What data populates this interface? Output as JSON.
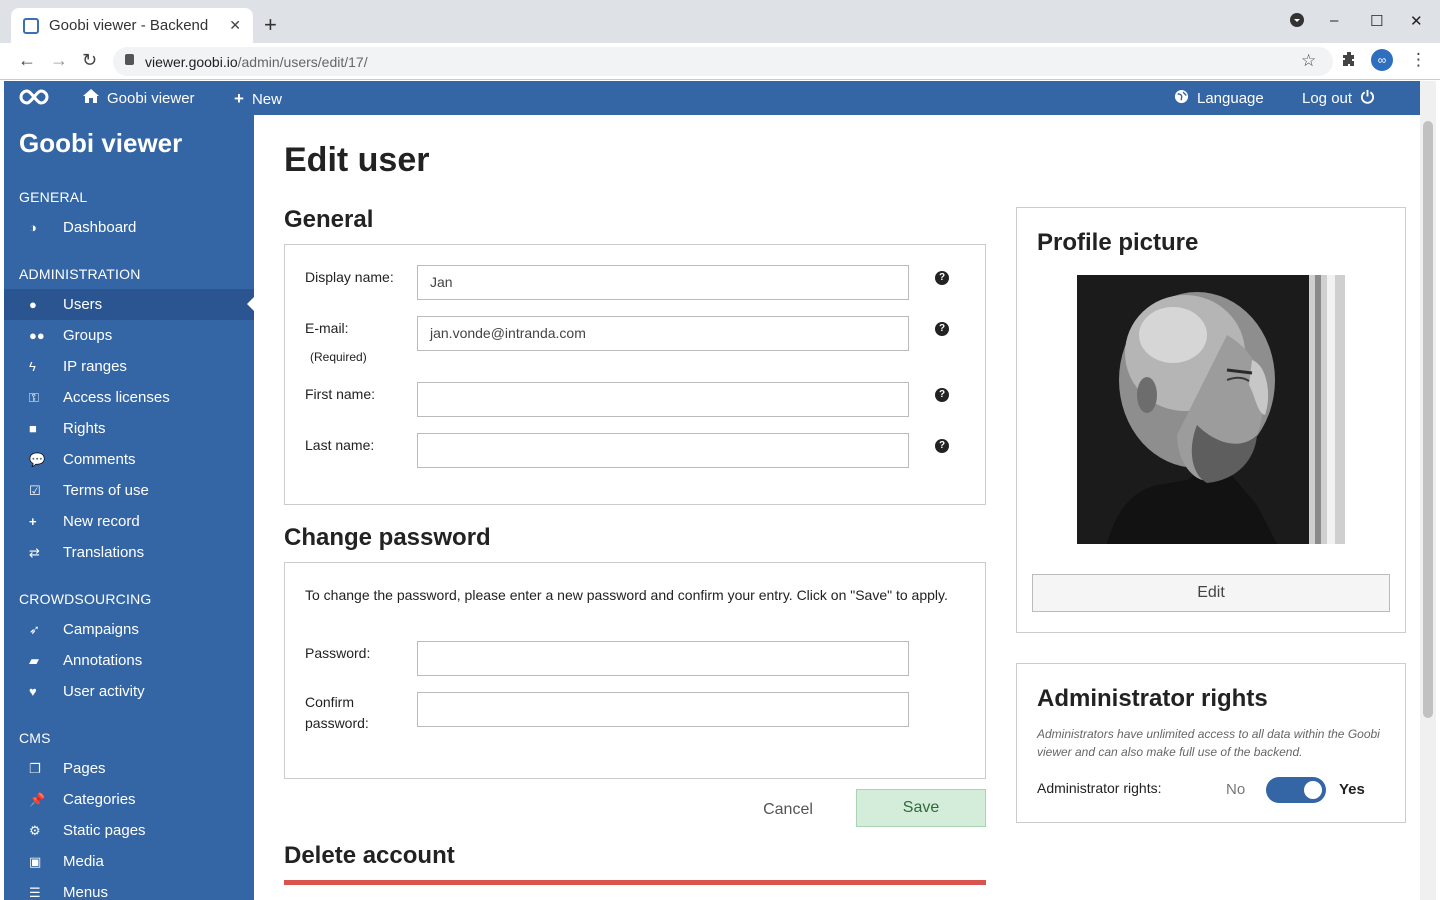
{
  "browser": {
    "tab_title": "Goobi viewer - Backend",
    "url_host": "viewer.goobi.io",
    "url_path": "/admin/users/edit/17/"
  },
  "topnav": {
    "home": "Goobi viewer",
    "new": "New",
    "language": "Language",
    "logout": "Log out"
  },
  "sidebar": {
    "brand": "Goobi viewer",
    "sections": {
      "general": "GENERAL",
      "administration": "ADMINISTRATION",
      "crowdsourcing": "CROWDSOURCING",
      "cms": "CMS"
    },
    "items": {
      "dashboard": "Dashboard",
      "users": "Users",
      "groups": "Groups",
      "ip_ranges": "IP ranges",
      "access_licenses": "Access licenses",
      "rights": "Rights",
      "comments": "Comments",
      "terms_of_use": "Terms of use",
      "new_record": "New record",
      "translations": "Translations",
      "campaigns": "Campaigns",
      "annotations": "Annotations",
      "user_activity": "User activity",
      "pages": "Pages",
      "categories": "Categories",
      "static_pages": "Static pages",
      "media": "Media",
      "menus": "Menus"
    }
  },
  "page": {
    "title": "Edit user",
    "general": {
      "heading": "General",
      "display_name_label": "Display name:",
      "display_name_value": "Jan",
      "email_label": "E-mail:",
      "email_required": "(Required)",
      "email_value": "jan.vonde@intranda.com",
      "first_name_label": "First name:",
      "first_name_value": "",
      "last_name_label": "Last name:",
      "last_name_value": "",
      "help": "?"
    },
    "password": {
      "heading": "Change password",
      "info": "To change the password, please enter a new password and confirm your entry. Click on \"Save\" to apply.",
      "password_label": "Password:",
      "confirm_label_1": "Confirm",
      "confirm_label_2": "password:"
    },
    "actions": {
      "cancel": "Cancel",
      "save": "Save"
    },
    "delete_heading": "Delete account",
    "profile": {
      "heading": "Profile picture",
      "edit": "Edit"
    },
    "admin": {
      "heading": "Administrator rights",
      "note": "Administrators have unlimited access to all data within the Goobi viewer and can also make full use of the backend.",
      "label": "Administrator rights:",
      "no": "No",
      "yes": "Yes",
      "enabled": true
    }
  },
  "colors": {
    "brand": "#3465a4",
    "save_bg": "#d4edda",
    "danger": "#d9534f"
  }
}
